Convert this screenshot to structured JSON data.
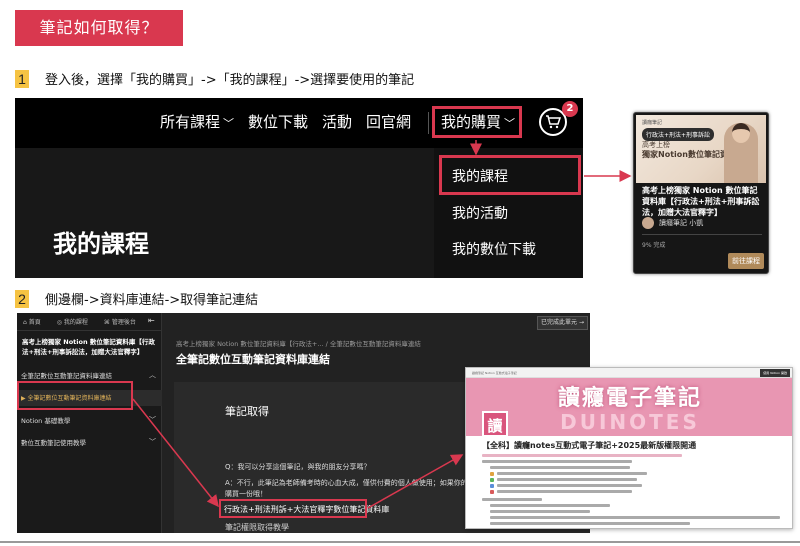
{
  "banner": {
    "title": "筆記如何取得？"
  },
  "step1": {
    "number": "1",
    "text": "登入後，選擇「我的購買」->「我的課程」->選擇要使用的筆記"
  },
  "step2": {
    "number": "2",
    "text": "側邊欄->資料庫連結->取得筆記連結"
  },
  "site": {
    "nav": {
      "courses": "所有課程",
      "downloads": "數位下載",
      "events": "活動",
      "official": "回官網",
      "purchases": "我的購買",
      "cart_count": "2"
    },
    "dropdown": [
      "我的課程",
      "我的活動",
      "我的數位下載"
    ],
    "page_heading": "我的課程"
  },
  "course_card": {
    "brand": "讀癮筆記",
    "highlight": "行政法+刑法+刑事訴訟",
    "image_line1": "高考上榜",
    "image_line2": "獨家Notion數位筆記資料庫",
    "title": "高考上榜獨家 Notion 數位筆記資料庫【行政法+刑法+刑事訴訟法，加贈大法官釋字】",
    "author": "讀癮筆記 小凱",
    "progress": "9% 完成",
    "button": "前往課程"
  },
  "lms": {
    "top_links": [
      "首頁",
      "我的課程",
      "管理後台"
    ],
    "collapse": "⇤",
    "course_title": "高考上榜獨家 Notion 數位筆記資料庫【行政法+刑法+刑事訴訟法，加贈大法官釋字】",
    "sections": {
      "s1": "全筆記數位互動筆記資料庫連結",
      "active_lesson": "全筆記數位互動筆記資料庫連結",
      "s2": "Notion 基礎教學",
      "s3": "數位互動筆記使用教學"
    },
    "breadcrumb": "高考上榜獨家 Notion 數位筆記資料庫【行政法+...   /   全筆記數位互動筆記資料庫連結",
    "lesson_title": "全筆記數位互動筆記資料庫連結",
    "done_button": "已完成此單元  →",
    "doc_heading": "筆記取得",
    "q": "Q：我可以分享這個筆記，與我的朋友分享嗎？",
    "a1": "A：不行，此筆記為老師備考時的心血大成，僅供付費的個人做使用；如果你的朋",
    "a2": "購買一份哦！",
    "db_link": "行政法+刑法刑訴+大法官釋字數位筆記資料庫",
    "perm_text": "筆記權限取得教學"
  },
  "notion": {
    "topbar": "讀癮筆記 Notion 互動式電子筆記",
    "topbar_btn": "使用 Notion 開啟",
    "cover_title": "讀癮電子筆記",
    "cover_sub": "DUINOTES",
    "logo": "讀",
    "title": "【全科】讀癮notes互動式電子筆記+2025最新版權限開通"
  },
  "colors": {
    "accent_red": "#d9384f",
    "step_yellow": "#f6c343",
    "notion_pink": "#e896b2"
  }
}
